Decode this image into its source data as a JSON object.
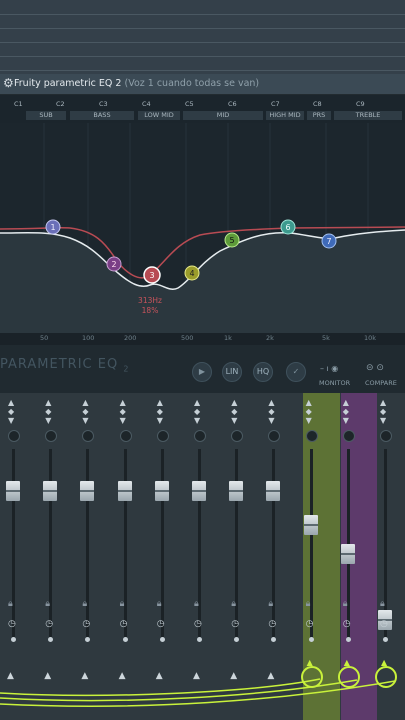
{
  "plugin_window": {
    "title": "Fruity parametric EQ 2",
    "subtitle": "(Voz 1 cuando todas se van)",
    "gear_icon": "gear-icon"
  },
  "band_notes": [
    "C1",
    "C2",
    "C3",
    "C4",
    "C5",
    "C6",
    "C7",
    "C8",
    "C9"
  ],
  "band_groups": [
    "SUB",
    "BASS",
    "LOW MID",
    "MID",
    "HIGH MID",
    "PRS",
    "TREBLE"
  ],
  "eq_graph": {
    "band_handles": [
      "1",
      "2",
      "3",
      "4",
      "5",
      "6",
      "7"
    ],
    "selected_readout": [
      "313Hz",
      "18%"
    ]
  },
  "freq_axis": [
    "50",
    "100",
    "200",
    "500",
    "1k",
    "2k",
    "5k",
    "10k"
  ],
  "plugin_bar": {
    "name": "PARAMETRIC EQ",
    "name_suffix": "2",
    "lin_label": "LIN",
    "hq_label": "HQ",
    "monitor_label": "MONITOR",
    "compare_label": "COMPARE"
  },
  "colors": {
    "curve_red": "#b84b53",
    "curve_white": "#e6ecef",
    "routed_green": "#c9f23b",
    "selected_strip_green": "#5d7235",
    "selected_strip_purple": "#5d3a6b"
  },
  "mixer": {
    "strip_count": 11,
    "fader_levels": [
      0.78,
      0.78,
      0.78,
      0.78,
      0.78,
      0.78,
      0.78,
      0.78,
      0.6,
      0.45,
      0.1
    ]
  }
}
